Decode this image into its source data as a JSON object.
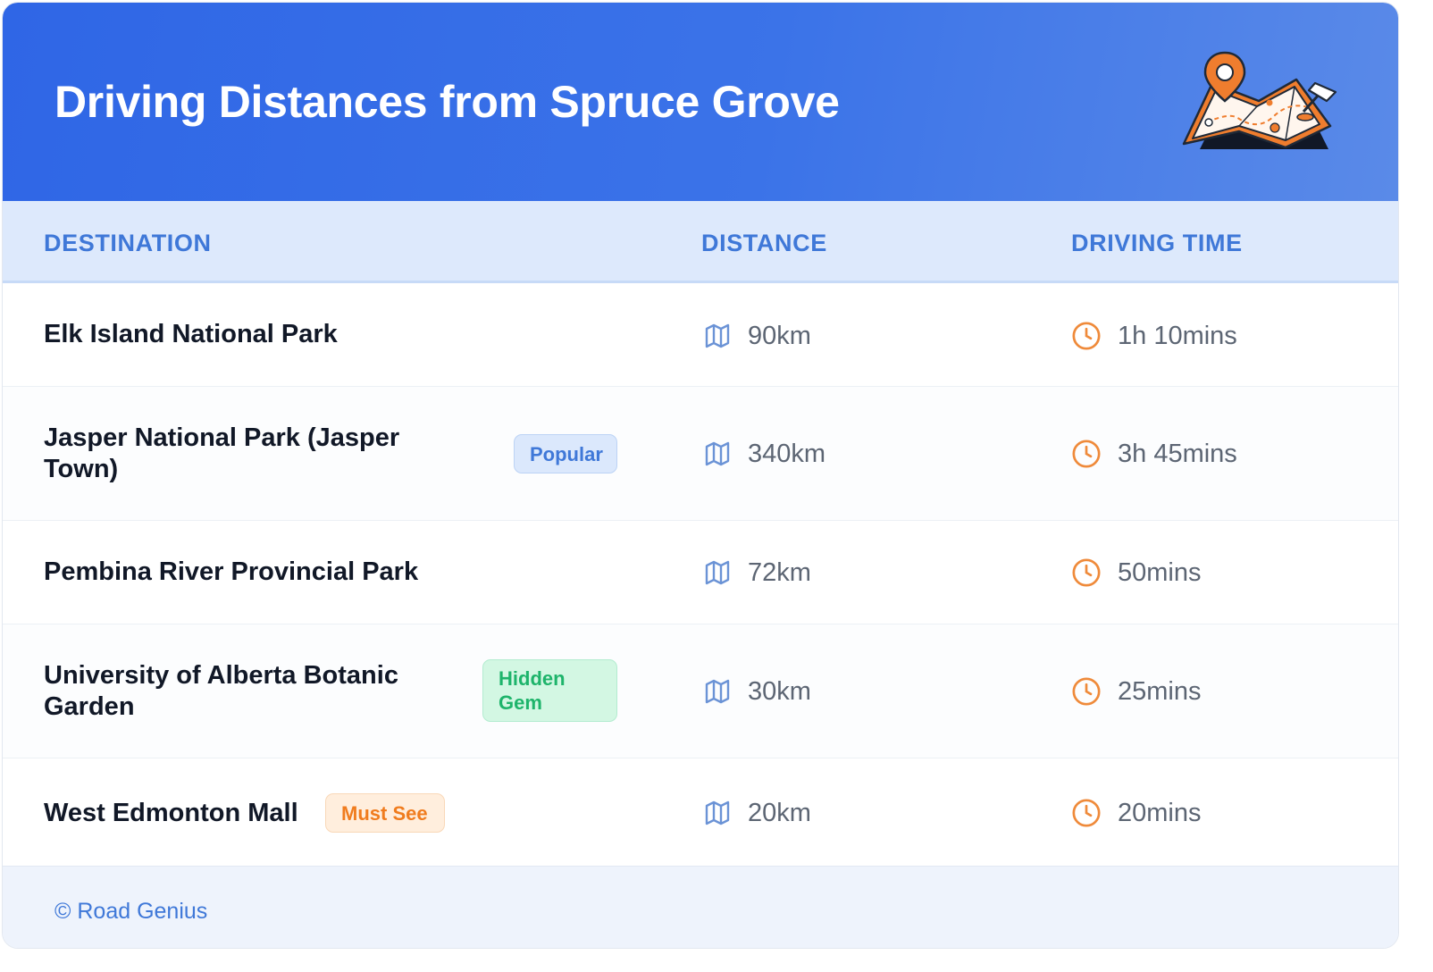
{
  "header": {
    "title": "Driving Distances from Spruce Grove",
    "illustration": "map-with-location-pin-icon"
  },
  "columns": {
    "destination": "DESTINATION",
    "distance": "DISTANCE",
    "driving_time": "DRIVING TIME"
  },
  "rows": [
    {
      "destination": "Elk Island National Park",
      "badge": null,
      "distance": "90km",
      "time": "1h 10mins"
    },
    {
      "destination": "Jasper National Park (Jasper Town)",
      "badge": "Popular",
      "distance": "340km",
      "time": "3h 45mins"
    },
    {
      "destination": "Pembina River Provincial Park",
      "badge": null,
      "distance": "72km",
      "time": "50mins"
    },
    {
      "destination": "University of Alberta Botanic Garden",
      "badge": "Hidden Gem",
      "distance": "30km",
      "time": "25mins"
    },
    {
      "destination": "West Edmonton Mall",
      "badge": "Must See",
      "distance": "20km",
      "time": "20mins"
    }
  ],
  "icons": {
    "distance": "map-icon",
    "time": "clock-icon"
  },
  "colors": {
    "header_blue": "#2f66e6",
    "accent_blue": "#3f78d8",
    "badge_green": "#1eb46b",
    "badge_orange": "#f07c1e",
    "icon_orange": "#ef8a3a"
  },
  "footer": {
    "text": "© Road Genius"
  }
}
